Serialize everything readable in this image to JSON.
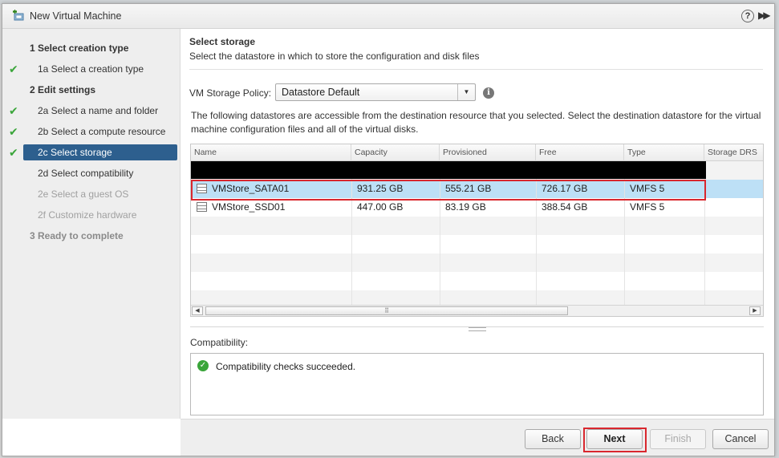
{
  "window": {
    "title": "New Virtual Machine",
    "help_icon": "question-circle-icon",
    "expand_icon": "double-chevron-right-icon"
  },
  "nav": {
    "items": [
      {
        "label": "1   Select creation type",
        "kind": "step",
        "checked": false,
        "state": "enabled"
      },
      {
        "label": "1a  Select a creation type",
        "kind": "sub",
        "checked": true,
        "state": "enabled"
      },
      {
        "label": "2   Edit settings",
        "kind": "step",
        "checked": false,
        "state": "enabled"
      },
      {
        "label": "2a  Select a name and folder",
        "kind": "sub",
        "checked": true,
        "state": "enabled"
      },
      {
        "label": "2b  Select a compute resource",
        "kind": "sub",
        "checked": true,
        "state": "enabled"
      },
      {
        "label": "2c  Select storage",
        "kind": "sub",
        "checked": true,
        "state": "selected"
      },
      {
        "label": "2d  Select compatibility",
        "kind": "sub",
        "checked": false,
        "state": "enabled"
      },
      {
        "label": "2e  Select a guest OS",
        "kind": "sub",
        "checked": false,
        "state": "disabled"
      },
      {
        "label": "2f  Customize hardware",
        "kind": "sub",
        "checked": false,
        "state": "disabled"
      },
      {
        "label": "3   Ready to complete",
        "kind": "step",
        "checked": false,
        "state": "disabled"
      }
    ]
  },
  "main": {
    "section_title": "Select storage",
    "section_desc": "Select the datastore in which to store the configuration and disk files",
    "policy_label": "VM Storage Policy:",
    "policy_value": "Datastore Default",
    "datastore_desc": "The following datastores are accessible from the destination resource that you selected. Select the destination datastore for the virtual machine configuration files and all of the virtual disks."
  },
  "grid": {
    "columns": [
      "Name",
      "Capacity",
      "Provisioned",
      "Free",
      "Type",
      "Storage DRS"
    ],
    "rows": [
      {
        "name": "VMStore_SATA01",
        "capacity": "931.25 GB",
        "provisioned": "555.21 GB",
        "free": "726.17 GB",
        "type": "VMFS 5",
        "storage_drs": "",
        "selected": true
      },
      {
        "name": "VMStore_SSD01",
        "capacity": "447.00 GB",
        "provisioned": "83.19 GB",
        "free": "388.54 GB",
        "type": "VMFS 5",
        "storage_drs": "",
        "selected": false
      }
    ],
    "scroll_left_glyph": "◀",
    "scroll_right_glyph": "▶",
    "scroll_grip_glyph": "⠿"
  },
  "compatibility": {
    "label": "Compatibility:",
    "message": "Compatibility checks succeeded.",
    "status_icon": "check-circle-icon",
    "status_color": "#3aa53a"
  },
  "footer": {
    "back_label": "Back",
    "next_label": "Next",
    "finish_label": "Finish",
    "cancel_label": "Cancel"
  },
  "colors": {
    "selected_nav": "#2d5f8e",
    "selected_row": "#bde0f6",
    "highlight_red": "#d9272e",
    "check_green": "#3aa53a"
  }
}
